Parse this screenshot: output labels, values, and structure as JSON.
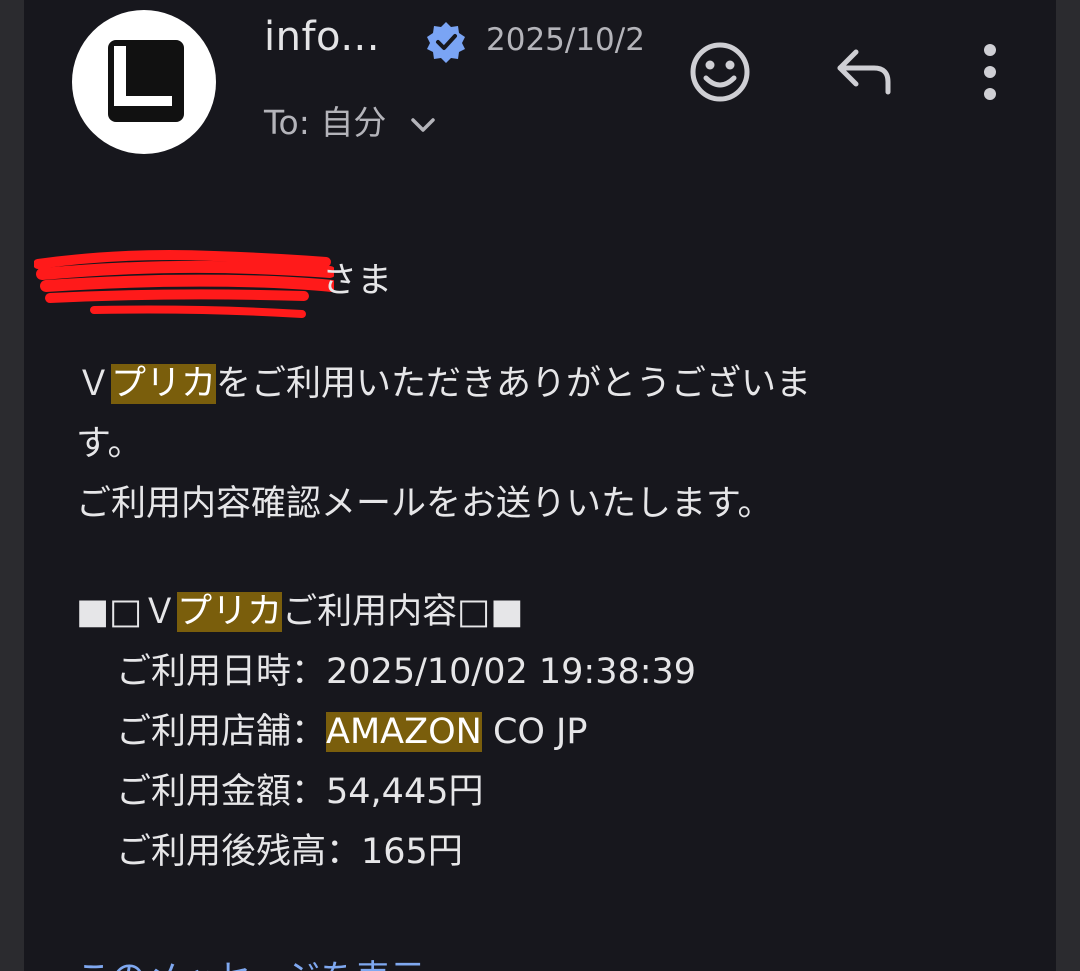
{
  "header": {
    "sender_name": "info...",
    "date": "2025/10/2",
    "to_label": "To: 自分",
    "icons": [
      "avatar-logo",
      "verified-badge-icon",
      "chevron-down-icon",
      "smiley-icon",
      "reply-icon",
      "more-vert-icon"
    ],
    "verified_color": "#7aa4f4"
  },
  "message": {
    "greeting_suffix": "さま",
    "p1_prefix": "Ｖ",
    "p1_highlight": "プリカ",
    "p1_rest": "をご利用いただきありがとうございま",
    "p1_cont": "す。",
    "p2": "ご利用内容確認メールをお送りいたします。",
    "section_prefix": "■□Ｖ",
    "section_highlight": "プリカ",
    "section_suffix": "ご利用内容□■",
    "rows": [
      {
        "label": "ご利用日時：",
        "value": "2025/10/02 19:38:39"
      },
      {
        "label": "ご利用店舗：",
        "value_highlight": "AMAZON",
        "value_rest": " CO JP"
      },
      {
        "label": "ご利用金額：",
        "value": "54,445円"
      },
      {
        "label": "ご利用後残高：",
        "value": "165円"
      }
    ],
    "link_text": "このメッセージを表示"
  },
  "colors": {
    "background": "#17171d",
    "highlight": "#7a5e0c",
    "link": "#7fa8f0",
    "redaction": "#ff1a1a"
  }
}
